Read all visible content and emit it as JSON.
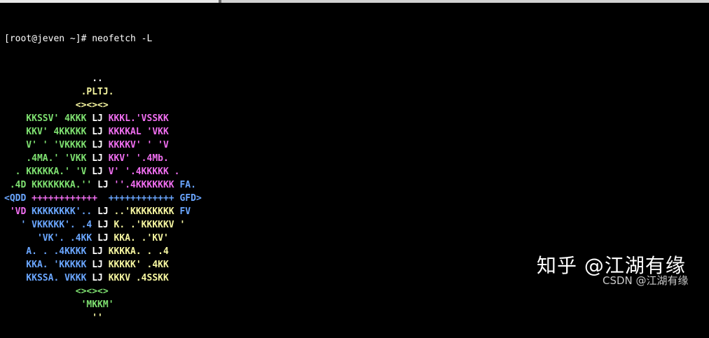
{
  "terminal": {
    "prompt": "[root@jeven ~]# ",
    "command": "neofetch -L"
  },
  "logo_lines": [
    [
      [
        "                ..",
        "white"
      ]
    ],
    [
      [
        "              .PLTJ.",
        "yellow"
      ]
    ],
    [
      [
        "             ",
        "white"
      ],
      [
        "<><><>",
        "yellow"
      ]
    ],
    [
      [
        "    KKSSV' 4KKK ",
        "green"
      ],
      [
        "LJ",
        "white"
      ],
      [
        " KKKL.'VSSKK",
        "magenta"
      ]
    ],
    [
      [
        "    KKV' 4KKKKK ",
        "green"
      ],
      [
        "LJ",
        "white"
      ],
      [
        " KKKKAL 'VKK",
        "magenta"
      ]
    ],
    [
      [
        "    V' ' 'VKKKK ",
        "green"
      ],
      [
        "LJ",
        "white"
      ],
      [
        " KKKKV' ' 'V",
        "magenta"
      ]
    ],
    [
      [
        "    .4MA.' 'VKK ",
        "green"
      ],
      [
        "LJ",
        "white"
      ],
      [
        " KKV' '.4Mb.",
        "magenta"
      ]
    ],
    [
      [
        "  . KKKKKA.' 'V ",
        "green"
      ],
      [
        "LJ",
        "white"
      ],
      [
        " V' '.4KKKKK .",
        "magenta"
      ]
    ],
    [
      [
        " .4D KKKKKKKA.'' ",
        "green"
      ],
      [
        "LJ",
        "white"
      ],
      [
        " ''.4KKKKKKK ",
        "magenta"
      ],
      [
        "FA.",
        "blue"
      ]
    ],
    [
      [
        "<QDD ",
        "blue"
      ],
      [
        "++++++++++++",
        "magenta"
      ],
      [
        "  ++++++++++++ ",
        "blue"
      ],
      [
        "GFD>",
        "blue"
      ]
    ],
    [
      [
        " 'VD ",
        "magenta"
      ],
      [
        "KKKKKKKK'.. ",
        "blue"
      ],
      [
        "LJ",
        "white"
      ],
      [
        " ..'KKKKKKKK ",
        "yellow"
      ],
      [
        "FV",
        "blue"
      ]
    ],
    [
      [
        "   ' VKKKKK'. .4 ",
        "blue"
      ],
      [
        "LJ",
        "white"
      ],
      [
        " K. .'KKKKKV '",
        "yellow"
      ]
    ],
    [
      [
        "      'VK'. .4KK ",
        "blue"
      ],
      [
        "LJ",
        "white"
      ],
      [
        " KKA. .'KV'",
        "yellow"
      ]
    ],
    [
      [
        "    A. . .4KKKK ",
        "blue"
      ],
      [
        "LJ",
        "white"
      ],
      [
        " KKKKA. . .4",
        "yellow"
      ]
    ],
    [
      [
        "    KKA. 'KKKKK ",
        "blue"
      ],
      [
        "LJ",
        "white"
      ],
      [
        " KKKKK' .4KK",
        "yellow"
      ]
    ],
    [
      [
        "    KKSSA. VKKK ",
        "blue"
      ],
      [
        "LJ",
        "white"
      ],
      [
        " KKKV .4SSKK",
        "yellow"
      ]
    ],
    [
      [
        "             ",
        "white"
      ],
      [
        "<><><>",
        "green"
      ]
    ],
    [
      [
        "              'MKKM'",
        "green"
      ]
    ],
    [
      [
        "                ''",
        "yellow"
      ]
    ]
  ],
  "watermark": {
    "main": "知乎 @江湖有缘",
    "sub": "CSDN @江湖有缘"
  }
}
